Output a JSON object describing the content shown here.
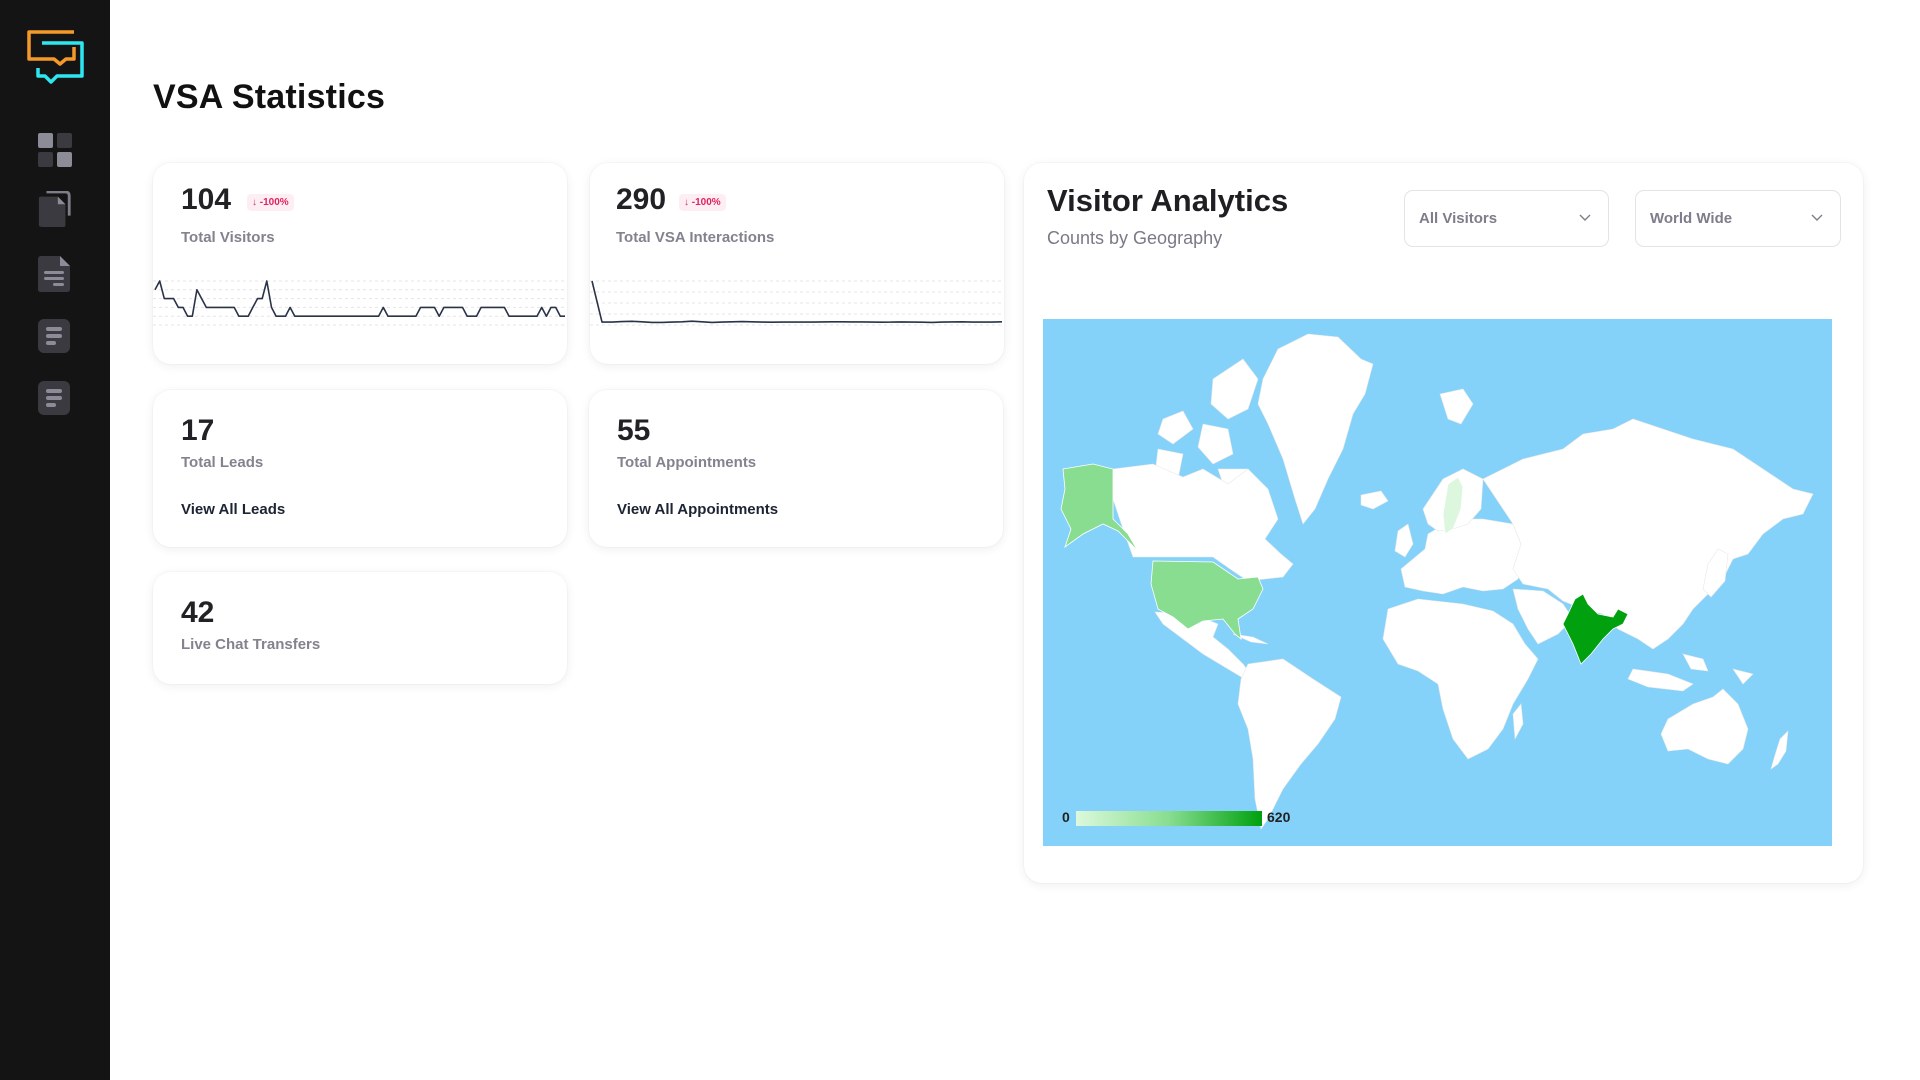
{
  "sidebar": {
    "logo": "chat-bubbles-logo",
    "items": [
      {
        "name": "dashboard",
        "icon": "dashboard-grid-icon",
        "active": true
      },
      {
        "name": "documents",
        "icon": "copy-document-icon"
      },
      {
        "name": "reports",
        "icon": "text-document-icon"
      },
      {
        "name": "list-1",
        "icon": "list-icon"
      },
      {
        "name": "list-2",
        "icon": "list-icon"
      }
    ]
  },
  "page": {
    "title": "VSA Statistics"
  },
  "stats": {
    "total_visitors": {
      "value": "104",
      "label": "Total Visitors",
      "change": "-100%",
      "change_direction": "down",
      "sparkline": [
        4,
        5,
        3,
        3,
        3,
        2,
        2,
        1,
        1,
        4,
        3,
        2,
        2,
        2,
        2,
        2,
        2,
        2,
        1,
        1,
        1,
        2,
        3,
        3,
        5,
        2,
        1,
        1,
        1,
        2,
        1,
        1,
        1,
        1,
        1,
        1,
        1,
        1,
        1,
        1,
        1,
        1,
        1,
        1,
        1,
        1,
        1,
        1,
        1,
        2,
        1,
        1,
        1,
        1,
        1,
        1,
        1,
        2,
        2,
        2,
        2,
        1,
        2,
        2,
        2,
        2,
        2,
        1,
        1,
        1,
        2,
        2,
        2,
        2,
        2,
        2,
        1,
        1,
        1,
        1,
        1,
        1,
        1,
        2,
        1,
        2,
        2,
        1,
        1
      ]
    },
    "total_vsa_interactions": {
      "value": "290",
      "label": "Total VSA Interactions",
      "change": "-100%",
      "change_direction": "down",
      "sparkline": [
        30,
        2,
        2,
        2.3,
        2.5,
        2.2,
        1.8,
        1.8,
        2,
        2.2,
        2.6,
        2.2,
        1.8,
        2,
        2.2,
        2.3,
        2.2,
        2,
        1.9,
        2,
        2,
        2,
        2,
        2.1,
        2.2,
        2.2,
        2.1,
        2.1,
        2,
        1.9,
        2,
        2.1,
        2,
        1.9,
        1.8,
        2,
        2.1,
        2.2,
        2,
        2,
        2,
        2.2
      ]
    },
    "total_leads": {
      "value": "17",
      "label": "Total Leads",
      "link": "View All Leads"
    },
    "total_appointments": {
      "value": "55",
      "label": "Total Appointments",
      "link": "View All Appointments"
    },
    "live_chat_transfers": {
      "value": "42",
      "label": "Live Chat Transfers"
    }
  },
  "visitor_analytics": {
    "title": "Visitor Analytics",
    "subtitle": "Counts by Geography",
    "filter_visitors": {
      "selected": "All Visitors"
    },
    "filter_region": {
      "selected": "World Wide"
    },
    "legend": {
      "min": "0",
      "max": "620",
      "color_min": "#dcf9dc",
      "color_max": "#00a00f"
    },
    "colors": {
      "ocean": "#84d2f9",
      "land": "#ffffff"
    },
    "highlighted_countries": [
      {
        "country": "India",
        "level": 1.0,
        "color": "#00a00f"
      },
      {
        "country": "United States",
        "level": 0.35,
        "color": "#88dd90"
      },
      {
        "country": "Sweden",
        "level": 0.05,
        "color": "#dcf7de"
      }
    ]
  }
}
